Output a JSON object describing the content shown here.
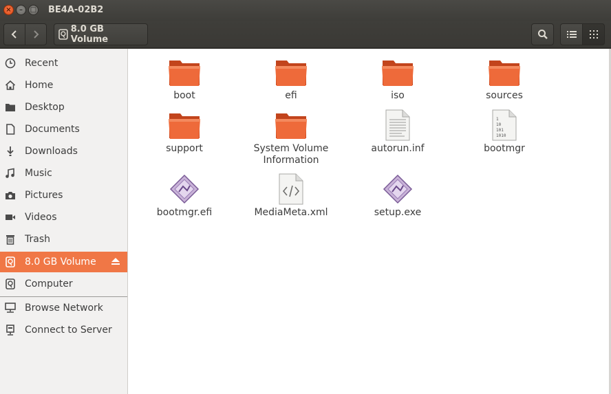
{
  "window": {
    "title": "BE4A-02B2"
  },
  "toolbar": {
    "location": "8.0 GB Volume"
  },
  "sidebar": {
    "items": [
      {
        "label": "Recent",
        "icon": "clock-icon"
      },
      {
        "label": "Home",
        "icon": "home-icon"
      },
      {
        "label": "Desktop",
        "icon": "desktop-folder-icon"
      },
      {
        "label": "Documents",
        "icon": "document-icon"
      },
      {
        "label": "Downloads",
        "icon": "download-icon"
      },
      {
        "label": "Music",
        "icon": "music-icon"
      },
      {
        "label": "Pictures",
        "icon": "camera-icon"
      },
      {
        "label": "Videos",
        "icon": "video-icon"
      },
      {
        "label": "Trash",
        "icon": "trash-icon"
      },
      {
        "label": "8.0 GB Volume",
        "icon": "drive-icon",
        "active": true
      },
      {
        "label": "Computer",
        "icon": "drive-icon"
      },
      {
        "label": "Browse Network",
        "icon": "network-icon"
      },
      {
        "label": "Connect to Server",
        "icon": "server-icon"
      }
    ]
  },
  "files": [
    {
      "name": "boot",
      "type": "folder"
    },
    {
      "name": "efi",
      "type": "folder"
    },
    {
      "name": "iso",
      "type": "folder"
    },
    {
      "name": "sources",
      "type": "folder"
    },
    {
      "name": "support",
      "type": "folder"
    },
    {
      "name": "System Volume\nInformation",
      "type": "folder"
    },
    {
      "name": "autorun.inf",
      "type": "text-file"
    },
    {
      "name": "bootmgr",
      "type": "binary-file"
    },
    {
      "name": "bootmgr.efi",
      "type": "executable"
    },
    {
      "name": "MediaMeta.xml",
      "type": "xml-file"
    },
    {
      "name": "setup.exe",
      "type": "executable"
    }
  ],
  "colors": {
    "accent": "#f07746",
    "folder": "#e9562a",
    "titlebar": "#3c3b37"
  }
}
